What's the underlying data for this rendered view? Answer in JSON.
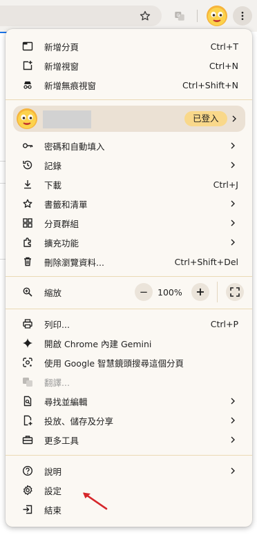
{
  "colors": {
    "menu_bg": "#fbf8f3",
    "separator": "#ead9b4",
    "signin_badge": "#f9d88a",
    "profile_bg": "#ebe1d4",
    "arrow": "#d6272b",
    "toolbar_bg": "#f3f1ee"
  },
  "toolbar": {
    "icons": [
      "bookmark-star-icon",
      "translate-icon",
      "profile-avatar-icon",
      "more-vert-icon"
    ]
  },
  "menu": {
    "top_items": [
      {
        "label": "新增分頁",
        "shortcut": "Ctrl+T",
        "icon": "new-tab-icon"
      },
      {
        "label": "新增視窗",
        "shortcut": "Ctrl+N",
        "icon": "new-window-icon"
      },
      {
        "label": "新增無痕視窗",
        "shortcut": "Ctrl+Shift+N",
        "icon": "incognito-icon"
      }
    ],
    "profile": {
      "badge": "已登入",
      "icon": "avatar-emoji-icon"
    },
    "middle_items": [
      {
        "label": "密碼和自動填入",
        "shortcut": "",
        "icon": "key-icon",
        "submenu": true
      },
      {
        "label": "記錄",
        "shortcut": "",
        "icon": "history-icon",
        "submenu": true
      },
      {
        "label": "下載",
        "shortcut": "Ctrl+J",
        "icon": "download-icon",
        "submenu": false
      },
      {
        "label": "書籤和清單",
        "shortcut": "",
        "icon": "star-icon",
        "submenu": true
      },
      {
        "label": "分頁群組",
        "shortcut": "",
        "icon": "tab-groups-icon",
        "submenu": true
      },
      {
        "label": "擴充功能",
        "shortcut": "",
        "icon": "extension-icon",
        "submenu": true
      },
      {
        "label": "刪除瀏覽資料...",
        "shortcut": "Ctrl+Shift+Del",
        "icon": "trash-icon",
        "submenu": false
      }
    ],
    "zoom": {
      "label": "縮放",
      "value": "100%",
      "minus": "−",
      "plus": "+",
      "icon": "zoom-icon"
    },
    "tools_items": [
      {
        "label": "列印...",
        "shortcut": "Ctrl+P",
        "icon": "print-icon",
        "submenu": false,
        "disabled": false
      },
      {
        "label": "開啟 Chrome 內建 Gemini",
        "shortcut": "",
        "icon": "gemini-sparkle-icon",
        "submenu": false,
        "disabled": false
      },
      {
        "label": "使用 Google 智慧鏡頭搜尋這個分頁",
        "shortcut": "",
        "icon": "google-lens-icon",
        "submenu": false,
        "disabled": false
      },
      {
        "label": "翻譯...",
        "shortcut": "",
        "icon": "translate-icon",
        "submenu": false,
        "disabled": true
      },
      {
        "label": "尋找並編輯",
        "shortcut": "",
        "icon": "find-edit-icon",
        "submenu": true,
        "disabled": false
      },
      {
        "label": "投放、儲存及分享",
        "shortcut": "",
        "icon": "cast-save-share-icon",
        "submenu": true,
        "disabled": false
      },
      {
        "label": "更多工具",
        "shortcut": "",
        "icon": "toolbox-icon",
        "submenu": true,
        "disabled": false
      }
    ],
    "bottom_items": [
      {
        "label": "說明",
        "shortcut": "",
        "icon": "help-icon",
        "submenu": true
      },
      {
        "label": "設定",
        "shortcut": "",
        "icon": "settings-gear-icon",
        "submenu": false
      },
      {
        "label": "結束",
        "shortcut": "",
        "icon": "exit-icon",
        "submenu": false
      }
    ]
  }
}
